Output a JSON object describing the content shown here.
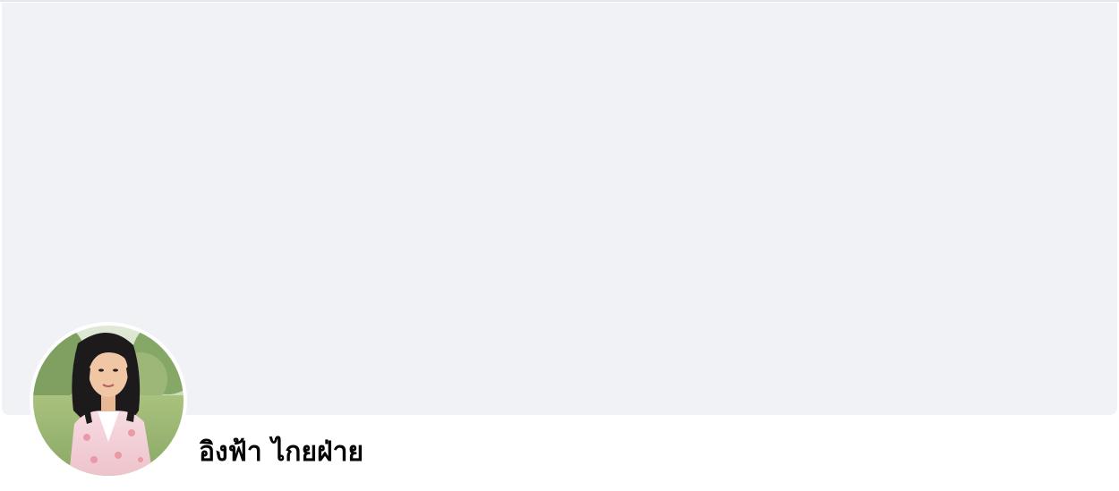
{
  "profile": {
    "name": "อิงฟ้า ไกยฝ่าย",
    "avatar_icon": "profile-photo"
  },
  "colors": {
    "cover_background": "#f0f2f5",
    "name_text": "#050505",
    "page_background": "#ffffff"
  }
}
